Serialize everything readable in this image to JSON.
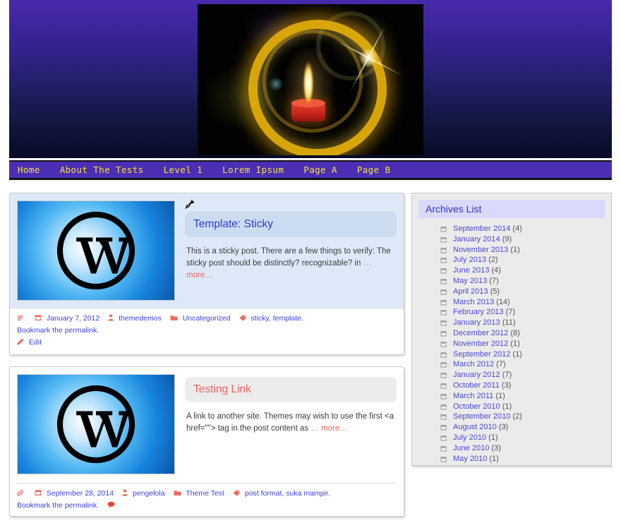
{
  "site": {
    "header_image_alt": "candle with glowing gold ring",
    "background_gradient_top": "#4729ab",
    "background_gradient_bottom": "#070a26"
  },
  "nav": {
    "accent_bg": "#4b2eb4",
    "accent_text": "#f2e03c",
    "items": [
      {
        "label": "Home"
      },
      {
        "label": "About The Tests"
      },
      {
        "label": "Level 1"
      },
      {
        "label": "Lorem Ipsum"
      },
      {
        "label": "Page A"
      },
      {
        "label": "Page B"
      }
    ]
  },
  "posts": [
    {
      "sticky": true,
      "pin_icon": "pushpin-icon",
      "title": "Template: Sticky",
      "title_color": "#2b3bd4",
      "excerpt": "This is a sticky post. There are a few things to verify: The sticky post should be distinctly? recognizable? in",
      "ellipsis": "…",
      "more_label": "more…",
      "meta": {
        "format_icon": "post-format-icon",
        "date_icon": "calendar-icon",
        "date": "January 7, 2012",
        "author_icon": "author-icon",
        "author": "themedemos",
        "category_icon": "folder-icon",
        "category": "Uncategorized",
        "tag_icon": "tag-icon",
        "tags": "sticky, template.",
        "bookmark_prefix": "Bookmark the",
        "permalink_label": "permalink.",
        "edit_icon": "pencil-icon",
        "edit_label": "Edit"
      }
    },
    {
      "sticky": false,
      "title": "Testing Link",
      "title_color": "#f4645f",
      "excerpt": "A link to another site. Themes may wish to use the first <a href=\"\"> tag in the post content as",
      "ellipsis": "…",
      "more_label": "more…",
      "meta": {
        "format_icon": "link-format-icon",
        "date_icon": "calendar-icon",
        "date": "September 28, 2014",
        "author_icon": "author-icon",
        "author": "pengelola",
        "category_icon": "folder-icon",
        "category": "Theme Test",
        "tag_icon": "tag-icon",
        "tags": "post format, suka mampir.",
        "bookmark_prefix": "Bookmark the",
        "permalink_label": "permalink.",
        "comment_icon": "comment-bubble-icon"
      }
    }
  ],
  "sidebar": {
    "widget_title": "Archives List",
    "widget_title_bg": "#d9d9fb",
    "widget_title_color": "#3333cc",
    "archives": [
      {
        "icon": "calendar-icon",
        "label": "September 2014",
        "count": "(4)"
      },
      {
        "icon": "calendar-icon",
        "label": "January 2014",
        "count": "(9)"
      },
      {
        "icon": "calendar-icon",
        "label": "November 2013",
        "count": "(1)"
      },
      {
        "icon": "calendar-icon",
        "label": "July 2013",
        "count": "(2)"
      },
      {
        "icon": "calendar-icon",
        "label": "June 2013",
        "count": "(4)"
      },
      {
        "icon": "calendar-icon",
        "label": "May 2013",
        "count": "(7)"
      },
      {
        "icon": "calendar-icon",
        "label": "April 2013",
        "count": "(5)"
      },
      {
        "icon": "calendar-icon",
        "label": "March 2013",
        "count": "(14)"
      },
      {
        "icon": "calendar-icon",
        "label": "February 2013",
        "count": "(7)"
      },
      {
        "icon": "calendar-icon",
        "label": "January 2013",
        "count": "(11)"
      },
      {
        "icon": "calendar-icon",
        "label": "December 2012",
        "count": "(8)"
      },
      {
        "icon": "calendar-icon",
        "label": "November 2012",
        "count": "(1)"
      },
      {
        "icon": "calendar-icon",
        "label": "September 2012",
        "count": "(1)"
      },
      {
        "icon": "calendar-icon",
        "label": "March 2012",
        "count": "(7)"
      },
      {
        "icon": "calendar-icon",
        "label": "January 2012",
        "count": "(7)"
      },
      {
        "icon": "calendar-icon",
        "label": "October 2011",
        "count": "(3)"
      },
      {
        "icon": "calendar-icon",
        "label": "March 2011",
        "count": "(1)"
      },
      {
        "icon": "calendar-icon",
        "label": "October 2010",
        "count": "(1)"
      },
      {
        "icon": "calendar-icon",
        "label": "September 2010",
        "count": "(2)"
      },
      {
        "icon": "calendar-icon",
        "label": "August 2010",
        "count": "(3)"
      },
      {
        "icon": "calendar-icon",
        "label": "July 2010",
        "count": "(1)"
      },
      {
        "icon": "calendar-icon",
        "label": "June 2010",
        "count": "(3)"
      },
      {
        "icon": "calendar-icon",
        "label": "May 2010",
        "count": "(1)"
      }
    ]
  }
}
